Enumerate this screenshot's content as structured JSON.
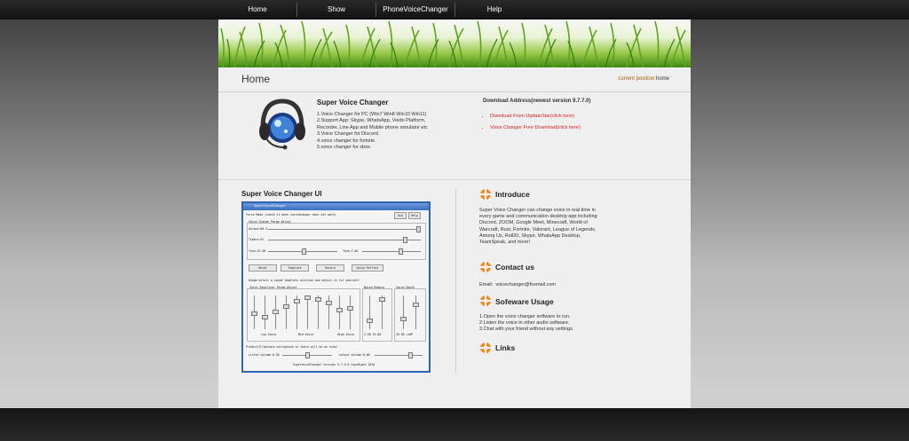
{
  "nav": {
    "items": [
      "Home",
      "Show",
      "PhoneVoiceChanger",
      "Help"
    ]
  },
  "header": {
    "title": "Home",
    "crumb_label": "current position:",
    "crumb_value": "home"
  },
  "product": {
    "title": "Super Voice Changer",
    "features": [
      "1.Voice Changer for PC (Win7 Win8 Win10 Win11)",
      "2.Support App: Skype, WhatsApp, Viedo Platform, Recorder, Line App and Mobile phone simulator etc",
      "3.Voice Changer for Discord.",
      "4.voice changer for fortnite.",
      "5.voice changer for xbox."
    ],
    "download_title": "Download Address(newest version 9.7.7.0)",
    "download_links": [
      "Download From UpdateStar(click here)",
      "Voice Changer Free Download(click here)"
    ]
  },
  "ui_section": {
    "title": "Super Voice Changer UI",
    "screenshot": {
      "window_title": "SuperVoiceChanger",
      "mode_label": "Force Mode (check it when voicechanger does not work)",
      "ask_btn": "Ask",
      "help_btn": "Help",
      "group_label": "Voice Change Param Adjust",
      "octave_label": "Octave:88.5",
      "timbre_label": "Timbre:0%",
      "tone_left": "Tone:51.00",
      "tone_right": "Tone:1.00",
      "buttons": [
        "Reset",
        "Template",
        "Record",
        "Voice Perfect"
      ],
      "hint": "Usage:select a voxed template solution and adjust it for yourself",
      "eq_label": "Voice Equalizer Param Adjust",
      "noise_label": "Noise Reduce",
      "depth_label": "Voice Depth",
      "low_label": "Low Voice",
      "mid_label": "Mid Voice",
      "high_label": "High Voice",
      "noise_vals": "3.00    15.00",
      "depth_vals": "20.00  +10P",
      "echo_label": "Predict/Eliminate microphone or there will be an echo!",
      "listen_label": "Listen volume:0.50",
      "output_label": "output volume:0.80",
      "footer": "SuperVoiceChanger Version 9.7.0.0 CopyRight 2018"
    }
  },
  "sidebar": {
    "intro_title": "Introduce",
    "intro_text": "Super Voice Changer can change voice in real time in every game and communication desktop app including Discord, ZOOM, Google Meet, Minecraft, World of Warcraft, Rust, Fortnite, Valorant, League of Legends, Among Us, Roll20, Skype, WhatsApp Desktop, TeamSpeak, and more!",
    "contact_title": "Contact us",
    "email_label": "Email:",
    "email_value": "voicechanger@foxmail.com",
    "usage_title": "Sofeware Usage",
    "usage_steps": [
      "1.Open the voice changer software to run.",
      "2.Listen the voice in other audio software.",
      "3.Chat with your friend without any settings."
    ],
    "links_title": "Links"
  }
}
